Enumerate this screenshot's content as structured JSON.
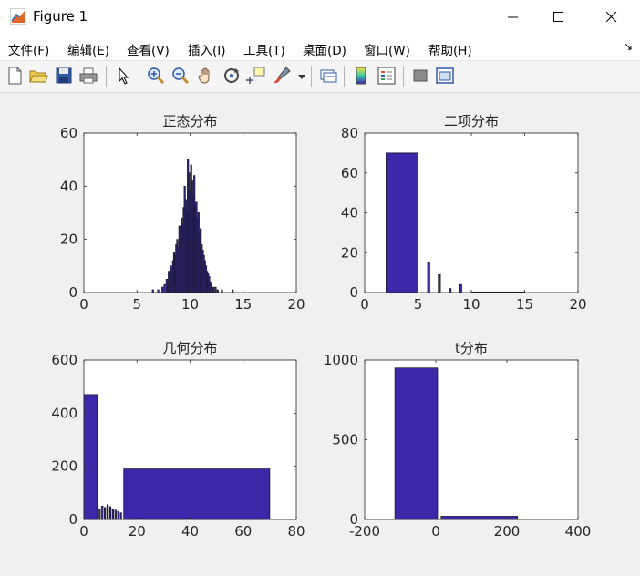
{
  "window": {
    "title": "Figure 1"
  },
  "menu": [
    "文件(F)",
    "编辑(E)",
    "查看(V)",
    "插入(I)",
    "工具(T)",
    "桌面(D)",
    "窗口(W)",
    "帮助(H)"
  ],
  "toolbar_icons": [
    "new-figure-icon",
    "open-icon",
    "save-icon",
    "print-icon",
    "pointer-icon",
    "zoom-in-icon",
    "zoom-out-icon",
    "pan-icon",
    "rotate-icon",
    "data-cursor-icon",
    "brush-icon",
    "link-icon",
    "colorbar-icon",
    "legend-icon",
    "hide-plot-tools-icon",
    "show-plot-tools-icon"
  ],
  "colors": {
    "bar_fill": "#3c28a8",
    "bar_edge": "#1a1a2e",
    "axes_bg": "#ffffff"
  },
  "chart_data": [
    {
      "type": "bar",
      "title": "正态分布",
      "xlim": [
        0,
        20
      ],
      "ylim": [
        0,
        60
      ],
      "xticks": [
        0,
        5,
        10,
        15,
        20
      ],
      "yticks": [
        0,
        20,
        40,
        60
      ],
      "bar_width": 0.12,
      "x": [
        6.5,
        7.0,
        7.4,
        7.6,
        7.8,
        7.9,
        8.0,
        8.1,
        8.2,
        8.3,
        8.4,
        8.5,
        8.6,
        8.7,
        8.8,
        8.9,
        9.0,
        9.1,
        9.2,
        9.3,
        9.4,
        9.5,
        9.6,
        9.7,
        9.8,
        9.9,
        10.0,
        10.1,
        10.2,
        10.3,
        10.4,
        10.5,
        10.6,
        10.7,
        10.8,
        10.9,
        11.0,
        11.1,
        11.2,
        11.3,
        11.4,
        11.5,
        11.6,
        11.7,
        11.8,
        11.9,
        12.0,
        12.2,
        12.4,
        12.6,
        13.0,
        14.0
      ],
      "values": [
        1,
        1,
        2,
        3,
        5,
        4,
        8,
        6,
        10,
        9,
        12,
        15,
        14,
        18,
        20,
        17,
        25,
        22,
        28,
        26,
        32,
        40,
        35,
        30,
        50,
        45,
        38,
        48,
        42,
        36,
        44,
        33,
        34,
        28,
        30,
        22,
        24,
        18,
        16,
        14,
        12,
        10,
        8,
        7,
        6,
        4,
        3,
        2,
        2,
        1,
        1,
        1
      ]
    },
    {
      "type": "bar",
      "title": "二项分布",
      "xlim": [
        0,
        20
      ],
      "ylim": [
        0,
        80
      ],
      "xticks": [
        0,
        5,
        10,
        15,
        20
      ],
      "yticks": [
        0,
        20,
        40,
        60,
        80
      ],
      "bars": [
        {
          "x0": 2.0,
          "x1": 5.0,
          "value": 70
        },
        {
          "x0": 5.9,
          "x1": 6.1,
          "value": 15
        },
        {
          "x0": 6.9,
          "x1": 7.1,
          "value": 9
        },
        {
          "x0": 7.9,
          "x1": 8.1,
          "value": 2
        },
        {
          "x0": 8.9,
          "x1": 9.1,
          "value": 4
        },
        {
          "x0": 10.0,
          "x1": 15.0,
          "value": 0.3
        }
      ]
    },
    {
      "type": "bar",
      "title": "几何分布",
      "xlim": [
        0,
        80
      ],
      "ylim": [
        0,
        600
      ],
      "xticks": [
        0,
        20,
        40,
        60,
        80
      ],
      "yticks": [
        0,
        200,
        400,
        600
      ],
      "bars": [
        {
          "x0": 0,
          "x1": 5,
          "value": 470
        },
        {
          "x0": 5.7,
          "x1": 6.2,
          "value": 40
        },
        {
          "x0": 6.7,
          "x1": 7.2,
          "value": 50
        },
        {
          "x0": 7.7,
          "x1": 8.2,
          "value": 45
        },
        {
          "x0": 8.7,
          "x1": 9.2,
          "value": 55
        },
        {
          "x0": 9.7,
          "x1": 10.2,
          "value": 48
        },
        {
          "x0": 10.7,
          "x1": 11.2,
          "value": 40
        },
        {
          "x0": 11.7,
          "x1": 12.2,
          "value": 35
        },
        {
          "x0": 12.7,
          "x1": 13.2,
          "value": 30
        },
        {
          "x0": 13.7,
          "x1": 14.2,
          "value": 25
        },
        {
          "x0": 15,
          "x1": 70,
          "value": 190
        }
      ]
    },
    {
      "type": "bar",
      "title": "t分布",
      "xlim": [
        -200,
        400
      ],
      "ylim": [
        0,
        1000
      ],
      "xticks": [
        -200,
        0,
        200,
        400
      ],
      "yticks": [
        0,
        500,
        1000
      ],
      "bars": [
        {
          "x0": -115,
          "x1": 5,
          "value": 950
        },
        {
          "x0": 15,
          "x1": 230,
          "value": 20
        }
      ]
    }
  ]
}
